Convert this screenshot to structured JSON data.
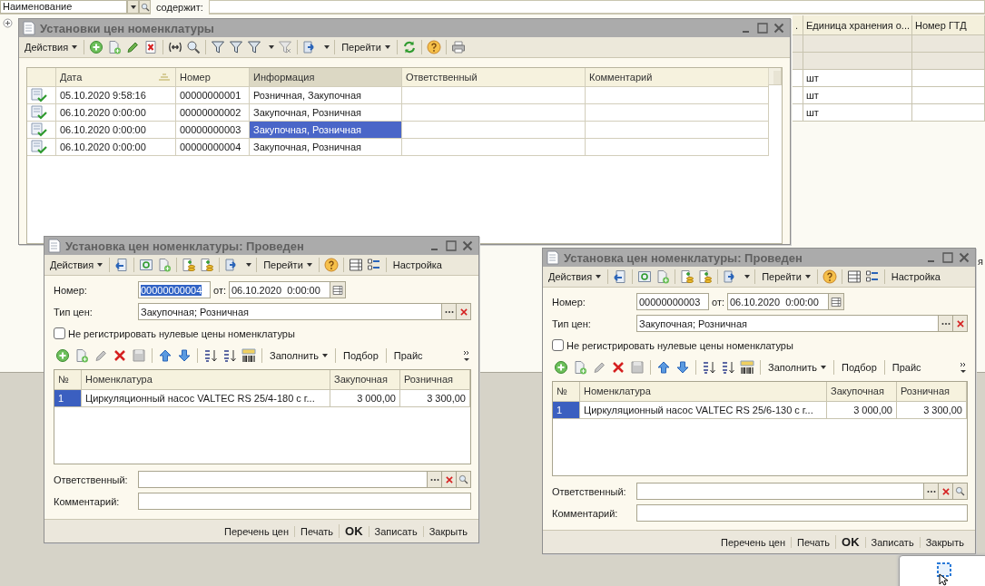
{
  "search_bar": {
    "field": "Наименование",
    "label": "содержит:"
  },
  "background_table": {
    "columns": [
      ".",
      "Единица хранения о...",
      "Номер ГТД"
    ],
    "rows": [
      {
        "column_2": "шт"
      },
      {
        "column_2": "шт"
      },
      {
        "column_2": "шт"
      }
    ],
    "fragment": "я"
  },
  "list_window": {
    "title": "Установки цен номенклатуры",
    "toolbar": [
      "Действия",
      "Перейти"
    ],
    "columns": [
      {
        "label": "Дата",
        "sorted": true,
        "selected": false
      },
      {
        "label": "Номер",
        "sorted": false,
        "selected": false
      },
      {
        "label": "Информация",
        "sorted": false,
        "selected": true
      },
      {
        "label": "Ответственный",
        "sorted": false,
        "selected": false
      },
      {
        "label": "Комментарий",
        "sorted": false,
        "selected": false
      }
    ],
    "rows": [
      {
        "date": "05.10.2020 9:58:16",
        "number": "00000000001",
        "info": "Розничная, Закупочная",
        "selected": false
      },
      {
        "date": "06.10.2020 0:00:00",
        "number": "00000000002",
        "info": "Закупочная, Розничная",
        "selected": false
      },
      {
        "date": "06.10.2020 0:00:00",
        "number": "00000000003",
        "info": "Закупочная, Розничная",
        "selected": true
      },
      {
        "date": "06.10.2020 0:00:00",
        "number": "00000000004",
        "info": "Закупочная, Розничная",
        "selected": false
      }
    ]
  },
  "document_windows": [
    {
      "title": "Установка цен номенклатуры: Проведен",
      "toolbar": [
        "Действия",
        "Перейти",
        "Настройка"
      ],
      "number_label": "Номер:",
      "number": "00000000004",
      "number_selected": true,
      "date_label": "от:",
      "date": "06.10.2020  0:00:00",
      "price_type_label": "Тип цен:",
      "price_type": "Закупочная; Розничная",
      "checkbox": {
        "label": "Не регистрировать нулевые цены номенклатуры",
        "checked": false
      },
      "table_toolbar": [
        "Заполнить",
        "Подбор",
        "Прайс"
      ],
      "columns": [
        "№",
        "Номенклатура",
        "Закупочная",
        "Розничная"
      ],
      "rows": [
        {
          "no": "1",
          "item": "Циркуляционный насос VALTEC RS 25/4-180 с г...",
          "purchase": "3 000,00",
          "retail": "3 300,00",
          "selected": true
        }
      ],
      "responsible_label": "Ответственный:",
      "comment_label": "Комментарий:",
      "buttons": [
        {
          "label": "Перечень цен",
          "default": false
        },
        {
          "label": "Печать",
          "default": false
        },
        {
          "label": "OK",
          "default": true
        },
        {
          "label": "Записать",
          "default": false
        },
        {
          "label": "Закрыть",
          "default": false
        }
      ]
    },
    {
      "title": "Установка цен номенклатуры: Проведен",
      "toolbar": [
        "Действия",
        "Перейти",
        "Настройка"
      ],
      "number_label": "Номер:",
      "number": "00000000003",
      "number_selected": false,
      "date_label": "от:",
      "date": "06.10.2020  0:00:00",
      "price_type_label": "Тип цен:",
      "price_type": "Закупочная; Розничная",
      "checkbox": {
        "label": "Не регистрировать нулевые цены номенклатуры",
        "checked": false
      },
      "table_toolbar": [
        "Заполнить",
        "Подбор",
        "Прайс"
      ],
      "columns": [
        "№",
        "Номенклатура",
        "Закупочная",
        "Розничная"
      ],
      "rows": [
        {
          "no": "1",
          "item": "Циркуляционный насос VALTEC RS 25/6-130 с г...",
          "purchase": "3 000,00",
          "retail": "3 300,00",
          "selected": true
        }
      ],
      "responsible_label": "Ответственный:",
      "comment_label": "Комментарий:",
      "buttons": [
        {
          "label": "Перечень цен",
          "default": false
        },
        {
          "label": "Печать",
          "default": false
        },
        {
          "label": "OK",
          "default": true
        },
        {
          "label": "Записать",
          "default": false
        },
        {
          "label": "Закрыть",
          "default": false
        }
      ]
    }
  ]
}
